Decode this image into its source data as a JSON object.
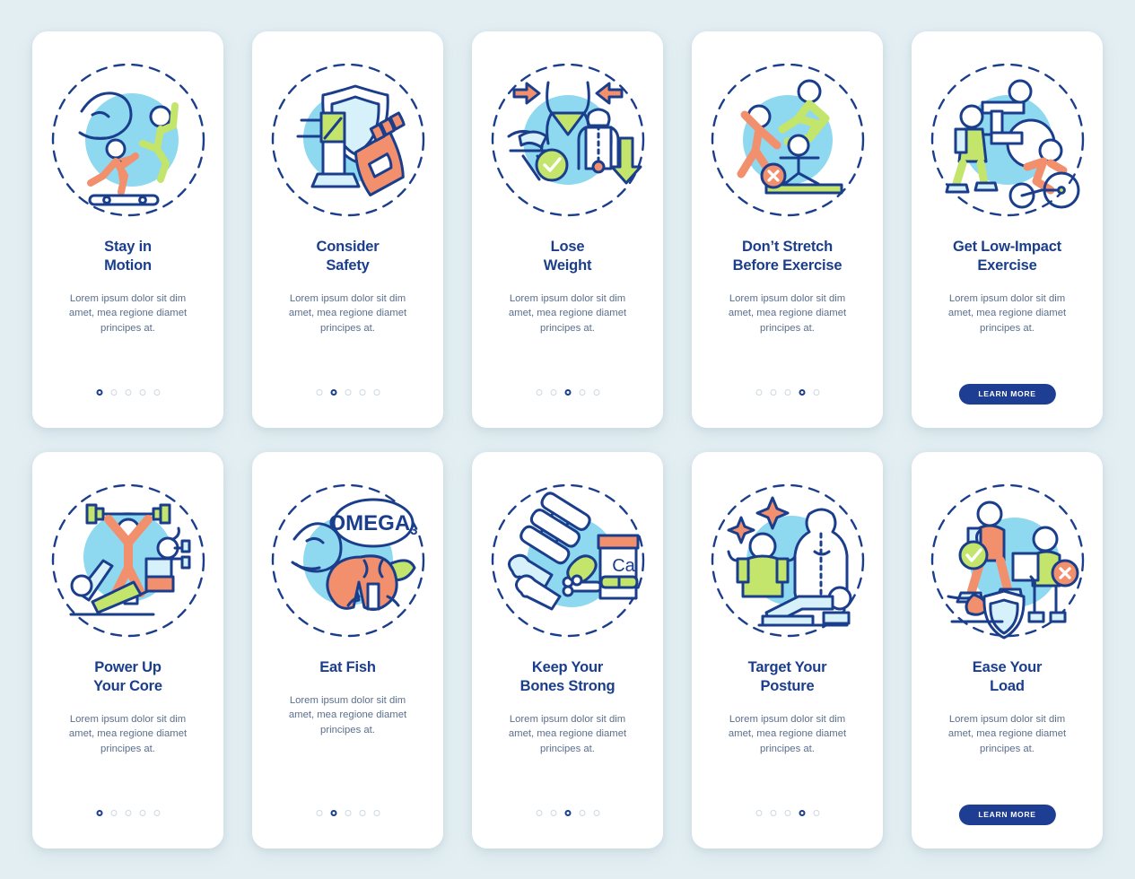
{
  "page": {
    "background_color": "#e2eef2",
    "card_background": "#ffffff",
    "title_color": "#1b3e8c",
    "body_color": "#5b6f8c",
    "accent_navy": "#1d3e93",
    "accent_coral": "#f2906e",
    "accent_green": "#c3e56b",
    "accent_lightblue": "#8ed8f0",
    "dot_inactive_color": "#cdd8e0",
    "shared_description": "Lorem ipsum dolor sit dim\namet, mea regione diamet\nprincipes at."
  },
  "cards": [
    {
      "id": "stay-in-motion",
      "title": "Stay in\nMotion",
      "description": "Lorem ipsum dolor sit dim\namet, mea regione diamet\nprincipes at.",
      "illustration": "runner-muscle-treadmill-icon",
      "footer_type": "dots",
      "dots_total": 5,
      "dots_active_index": 1
    },
    {
      "id": "consider-safety",
      "title": "Consider\nSafety",
      "description": "Lorem ipsum dolor sit dim\namet, mea regione diamet\nprincipes at.",
      "illustration": "shield-kneepad-glove-icon",
      "footer_type": "dots",
      "dots_total": 5,
      "dots_active_index": 2
    },
    {
      "id": "lose-weight",
      "title": "Lose\nWeight",
      "description": "Lorem ipsum dolor sit dim\namet, mea regione diamet\nprincipes at.",
      "illustration": "waist-arrows-body-scale-icon",
      "footer_type": "dots",
      "dots_total": 5,
      "dots_active_index": 3
    },
    {
      "id": "dont-stretch-before-exercise",
      "title": "Don’t Stretch\nBefore Exercise",
      "description": "Lorem ipsum dolor sit dim\namet, mea regione diamet\nprincipes at.",
      "illustration": "stretching-figures-forbidden-icon",
      "footer_type": "dots",
      "dots_total": 5,
      "dots_active_index": 4
    },
    {
      "id": "get-low-impact-exercise",
      "title": "Get Low-Impact\nExercise",
      "description": "Lorem ipsum dolor sit dim\namet, mea regione diamet\nprincipes at.",
      "illustration": "walker-swimmer-cyclist-icon",
      "footer_type": "button",
      "button_label": "LEARN MORE"
    },
    {
      "id": "power-up-your-core",
      "title": "Power Up\nYour Core",
      "description": "Lorem ipsum dolor sit dim\namet, mea regione diamet\nprincipes at.",
      "illustration": "barbell-dumbbell-bench-icon",
      "footer_type": "dots",
      "dots_total": 5,
      "dots_active_index": 1
    },
    {
      "id": "eat-fish",
      "title": "Eat Fish",
      "description": "Lorem ipsum dolor sit dim\namet, mea regione diamet\nprincipes at.",
      "illustration": "omega3-salmon-arm-icon",
      "illustration_label": "OMEGA",
      "illustration_label_sub": "3",
      "footer_type": "dots",
      "dots_total": 5,
      "dots_active_index": 2
    },
    {
      "id": "keep-your-bones-strong",
      "title": "Keep Your\nBones Strong",
      "description": "Lorem ipsum dolor sit dim\namet, mea regione diamet\nprincipes at.",
      "illustration": "spine-bones-calcium-bottle-icon",
      "illustration_label": "Ca",
      "footer_type": "dots",
      "dots_total": 5,
      "dots_active_index": 3
    },
    {
      "id": "target-your-posture",
      "title": "Target Your\nPosture",
      "description": "Lorem ipsum dolor sit dim\namet, mea regione diamet\nprincipes at.",
      "illustration": "posture-spine-plank-icon",
      "footer_type": "dots",
      "dots_total": 5,
      "dots_active_index": 4
    },
    {
      "id": "ease-your-load",
      "title": "Ease Your\nLoad",
      "description": "Lorem ipsum dolor sit dim\namet, mea regione diamet\nprincipes at.",
      "illustration": "backpack-lifting-shield-icon",
      "footer_type": "button",
      "button_label": "LEARN MORE"
    }
  ]
}
